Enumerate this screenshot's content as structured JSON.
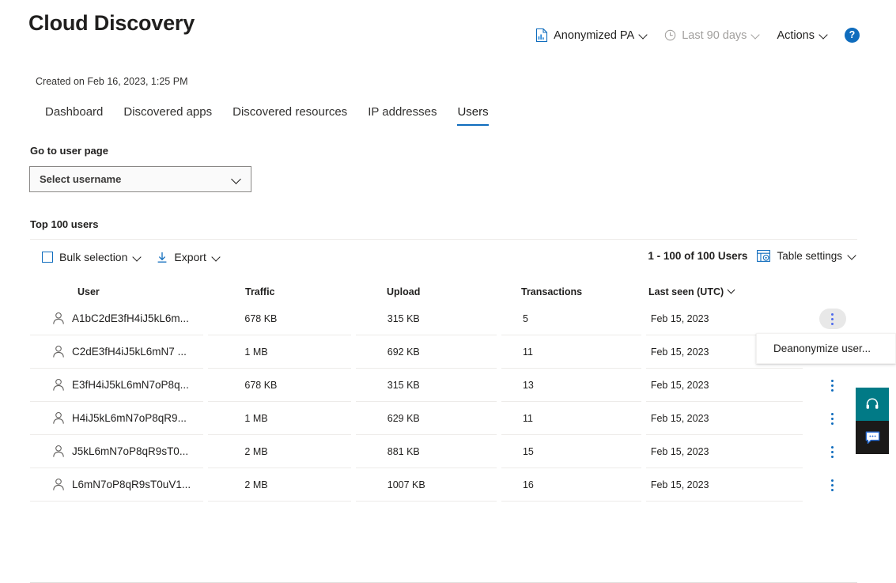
{
  "header": {
    "title": "Cloud Discovery",
    "controls": [
      {
        "label": "Anonymized PA",
        "icon": "report-icon",
        "disabled": false,
        "chevron": true
      },
      {
        "label": "Last 90 days",
        "icon": "clock-icon",
        "disabled": true,
        "chevron": true
      },
      {
        "label": "Actions",
        "icon": "",
        "disabled": false,
        "chevron": true
      }
    ],
    "help_label": "?"
  },
  "created": "Created on Feb 16, 2023, 1:25 PM",
  "tabs": [
    {
      "label": "Dashboard",
      "active": false
    },
    {
      "label": "Discovered apps",
      "active": false
    },
    {
      "label": "Discovered resources",
      "active": false
    },
    {
      "label": "IP addresses",
      "active": false
    },
    {
      "label": "Users",
      "active": true
    }
  ],
  "user_page": {
    "label": "Go to user page",
    "select_value": "Select username"
  },
  "table_section": {
    "title": "Top 100 users",
    "toolbar": {
      "bulk_selection": "Bulk selection",
      "export": "Export",
      "count": "1 - 100 of 100 Users",
      "table_settings": "Table settings"
    },
    "columns": [
      "User",
      "Traffic",
      "Upload",
      "Transactions",
      "Last seen (UTC)"
    ],
    "sorted_column": "Last seen (UTC)",
    "rows": [
      {
        "user": "A1bC2dE3fH4iJ5kL6m...",
        "traffic": "678 KB",
        "upload": "315 KB",
        "transactions": "5",
        "last_seen": "Feb 15, 2023",
        "menu_active": true
      },
      {
        "user": "C2dE3fH4iJ5kL6mN7 ...",
        "traffic": "1 MB",
        "upload": "692 KB",
        "transactions": "11",
        "last_seen": "Feb 15, 2023",
        "menu_active": false
      },
      {
        "user": "E3fH4iJ5kL6mN7oP8q...",
        "traffic": "678 KB",
        "upload": "315 KB",
        "transactions": "13",
        "last_seen": "Feb 15, 2023",
        "menu_active": false
      },
      {
        "user": "H4iJ5kL6mN7oP8qR9...",
        "traffic": "1 MB",
        "upload": "629 KB",
        "transactions": "11",
        "last_seen": "Feb 15, 2023",
        "menu_active": false
      },
      {
        "user": "J5kL6mN7oP8qR9sT0...",
        "traffic": "2 MB",
        "upload": "881 KB",
        "transactions": "15",
        "last_seen": "Feb 15, 2023",
        "menu_active": false
      },
      {
        "user": "L6mN7oP8qR9sT0uV1...",
        "traffic": "2 MB",
        "upload": "1007 KB",
        "transactions": "16",
        "last_seen": "Feb 15, 2023",
        "menu_active": false
      }
    ]
  },
  "context_menu": {
    "items": [
      "Deanonymize user..."
    ]
  },
  "side_buttons": [
    {
      "name": "support-button",
      "icon": "headset-icon"
    },
    {
      "name": "feedback-button",
      "icon": "chat-icon"
    }
  ],
  "colors": {
    "accent": "#0f6cbd",
    "support_teal": "#017a86",
    "feedback_dark": "#1b1a19",
    "divider": "#edebe9"
  }
}
